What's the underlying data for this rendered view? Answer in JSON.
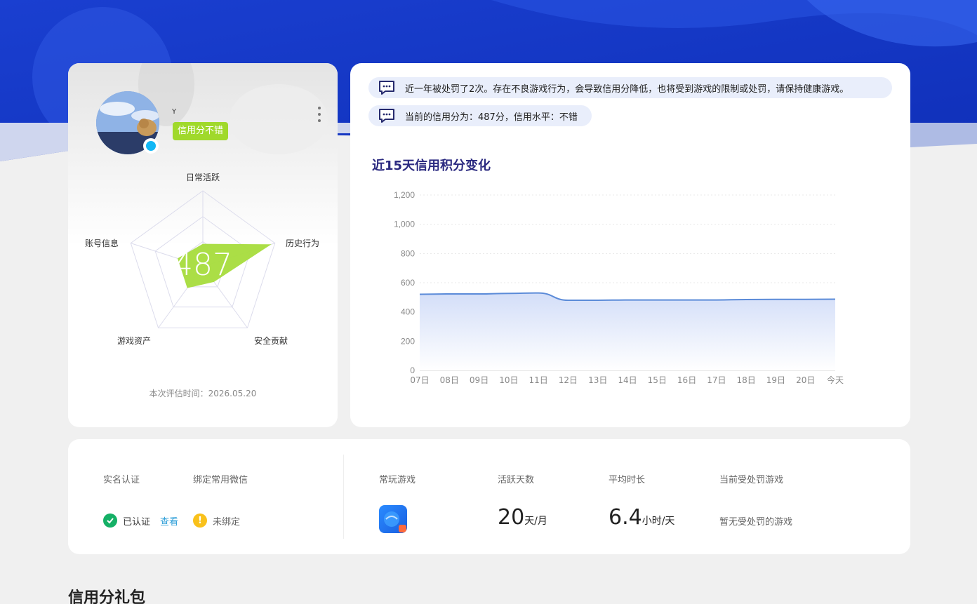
{
  "profile": {
    "nickname": "Y",
    "credit_badge": "信用分不错",
    "score": "487",
    "radar_labels": {
      "daily": "日常活跃",
      "history": "历史行为",
      "security": "安全贡献",
      "assets": "游戏资产",
      "account": "账号信息"
    },
    "radar_values": [
      0.3,
      0.95,
      0.25,
      0.35,
      0.35
    ],
    "eval_time": "本次评估时间：2026.05.20"
  },
  "notices": {
    "penalty": "近一年被处罚了2次。存在不良游戏行为，会导致信用分降低，也将受到游戏的限制或处罚，请保持健康游戏。",
    "current": "当前的信用分为：487分，信用水平：不错"
  },
  "chart_data": {
    "type": "area",
    "title": "近15天信用积分变化",
    "categories": [
      "07日",
      "08日",
      "09日",
      "10日",
      "11日",
      "12日",
      "13日",
      "14日",
      "15日",
      "16日",
      "17日",
      "18日",
      "19日",
      "20日",
      "今天"
    ],
    "series": [
      {
        "values": [
          521,
          523,
          523,
          527,
          530,
          480,
          480,
          482,
          482,
          482,
          482,
          485,
          486,
          486,
          487
        ]
      }
    ],
    "ylim": [
      0,
      1200
    ],
    "yticks": [
      "0",
      "200",
      "400",
      "600",
      "800",
      "1,000",
      "1,200"
    ],
    "grid": true,
    "line_color": "#5b8bd8"
  },
  "stats": {
    "realname_label": "实名认证",
    "realname_status": "已认证",
    "realname_view": "查看",
    "wechat_label": "绑定常用微信",
    "wechat_status": "未绑定",
    "games_label": "常玩游戏",
    "active_label": "活跃天数",
    "active_value": "20",
    "active_unit": "天/月",
    "duration_label": "平均时长",
    "duration_value": "6.4",
    "duration_unit": "小时/天",
    "penalty_label": "当前受处罚游戏",
    "penalty_value": "暂无受处罚的游戏"
  },
  "section": {
    "gift_title": "信用分礼包"
  },
  "colors": {
    "banner": "#1a3fcc",
    "badge": "#a0d92b",
    "radar_fill": "#a6dc3c",
    "title": "#2b2a80"
  }
}
